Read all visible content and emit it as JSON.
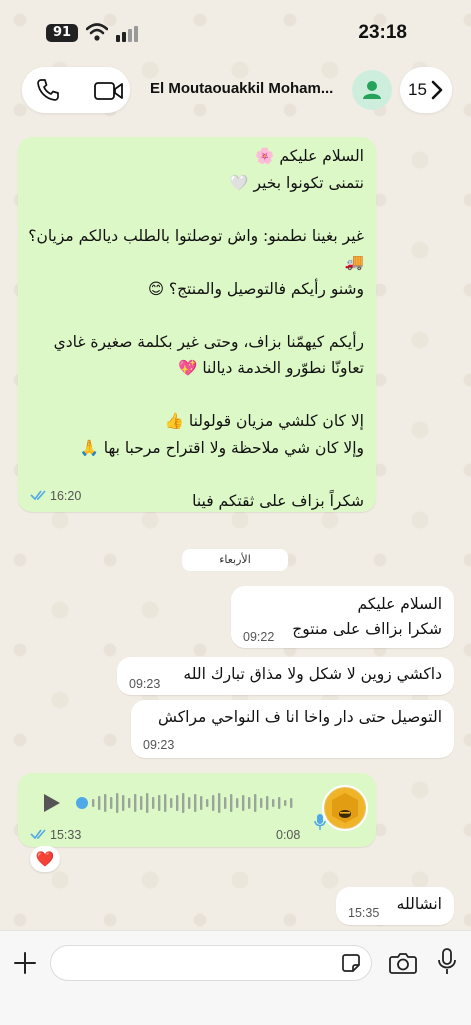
{
  "status_bar": {
    "battery": "91",
    "time": "23:18"
  },
  "header": {
    "contact_name": "El Moutaouakkil Moham...",
    "back_count": "15"
  },
  "messages": [
    {
      "text": "السلام عليكم 🌸\nنتمنى تكونوا بخير 🤍\n\nغير بغينا نطمنو: واش توصلتوا بالطلب ديالكم مزيان؟ 🚚\nوشنو رأيكم فالتوصيل والمنتج؟ 😊\n\nرأيكم كيهمّنا بزاف، وحتى غير بكلمة صغيرة غادي تعاونّا نطوّرو الخدمة ديالنا 💖\n\nإلا كان كلشي مزيان قولولنا 👍\nوإلا كان شي ملاحظة ولا اقتراح مرحبا بها 🙏\n\nشكراً بزاف على ثقتكم فينا",
      "time": "16:20"
    }
  ],
  "day_divider": "الأربعاء",
  "incoming": [
    {
      "text": "السلام عليكم\nشكرا بزااف على منتوج",
      "time": "09:22"
    },
    {
      "text": "داكشي زوين لا شكل ولا مذاق تبارك الله",
      "time": "09:23"
    },
    {
      "text": "التوصيل حتى دار واخا انا ف النواحي مراكش",
      "time": "09:23"
    }
  ],
  "voice_note": {
    "time": "15:33",
    "duration": "0:08",
    "avatar_text": "نحلة الأبرار"
  },
  "reaction": "❤️",
  "last_message": {
    "text": "انشالله",
    "time": "15:35"
  },
  "colors": {
    "outgoing_bubble": "#dcf8c6",
    "incoming_bubble": "#ffffff",
    "accent": "#25a35a",
    "ticks": "#4fa8e8"
  }
}
